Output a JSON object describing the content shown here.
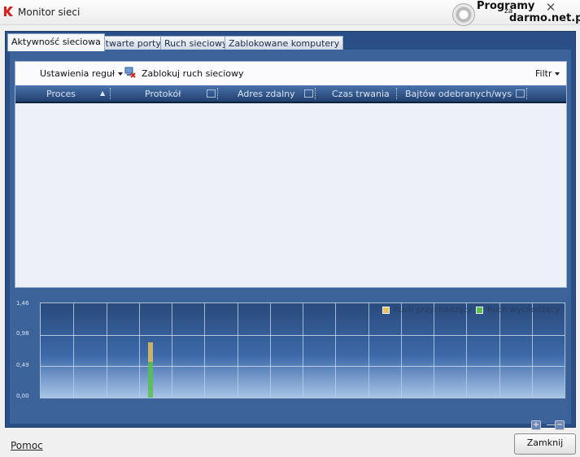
{
  "window": {
    "title": "Monitor sieci",
    "close_glyph": "✕"
  },
  "watermark": {
    "line1": "Programy",
    "line2": "za",
    "line3": "darmo.net.pl"
  },
  "tabs": [
    {
      "label": "Aktywność sieciowa",
      "active": true
    },
    {
      "label": "Otwarte porty",
      "active": false
    },
    {
      "label": "Ruch sieciowy",
      "active": false
    },
    {
      "label": "Zablokowane komputery",
      "active": false
    }
  ],
  "toolbar": {
    "rules_label": "Ustawienia reguł",
    "block_label": "Zablokuj ruch sieciowy",
    "filter_label": "Filtr"
  },
  "table": {
    "columns": [
      "Proces",
      "Protokół",
      "Adres zdalny",
      "Czas trwania",
      "Bajtów odebranych/wysł..."
    ],
    "rows": []
  },
  "chart_data": {
    "type": "bar",
    "y_ticks": [
      "1,46",
      "0,98",
      "0,49",
      "0,00"
    ],
    "ylim": [
      0,
      1.46
    ],
    "grid": true,
    "legend": "top-right",
    "series": [
      {
        "name": "Ruch przychodzący",
        "color": "#e8c063",
        "values": [
          0,
          0,
          0,
          0.3,
          0,
          0,
          0,
          0,
          0,
          0,
          0,
          0,
          0,
          0,
          0,
          0
        ]
      },
      {
        "name": "Ruch wychodzący",
        "color": "#56c24c",
        "values": [
          0,
          0,
          0,
          0.55,
          0,
          0,
          0,
          0,
          0,
          0,
          0,
          0,
          0,
          0,
          0,
          0
        ]
      }
    ]
  },
  "footer": {
    "help_label": "Pomoc",
    "close_label": "Zamknij"
  },
  "colors": {
    "accent": "#2a4f86",
    "panel": "#3c649a"
  }
}
